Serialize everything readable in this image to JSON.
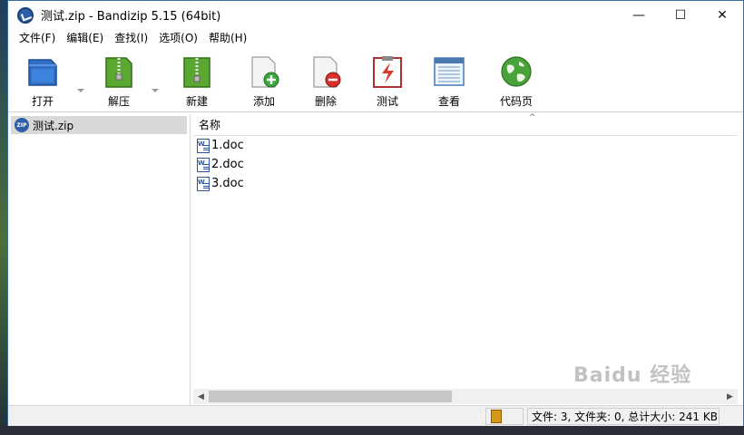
{
  "window": {
    "title": "测试.zip - Bandizip 5.15 (64bit)",
    "buttons": {
      "minimize": "—",
      "maximize": "☐",
      "close": "✕"
    }
  },
  "menu": [
    "文件(F)",
    "编辑(E)",
    "查找(I)",
    "选项(O)",
    "帮助(H)"
  ],
  "toolbar": {
    "open": "打开",
    "extract": "解压",
    "new": "新建",
    "add": "添加",
    "delete": "删除",
    "test": "测试",
    "view": "查看",
    "codepage": "代码页"
  },
  "tree": {
    "root": "测试.zip"
  },
  "file_list": {
    "column_name": "名称",
    "files": [
      "1.doc",
      "2.doc",
      "3.doc"
    ]
  },
  "status": {
    "summary": "文件: 3, 文件夹: 0, 总计大小: 241 KB"
  },
  "watermark": "Baidu 经验",
  "colors": {
    "accent": "#3a6ea5",
    "selection": "#d9d9d9",
    "statusbar": "#f0f0f0"
  }
}
